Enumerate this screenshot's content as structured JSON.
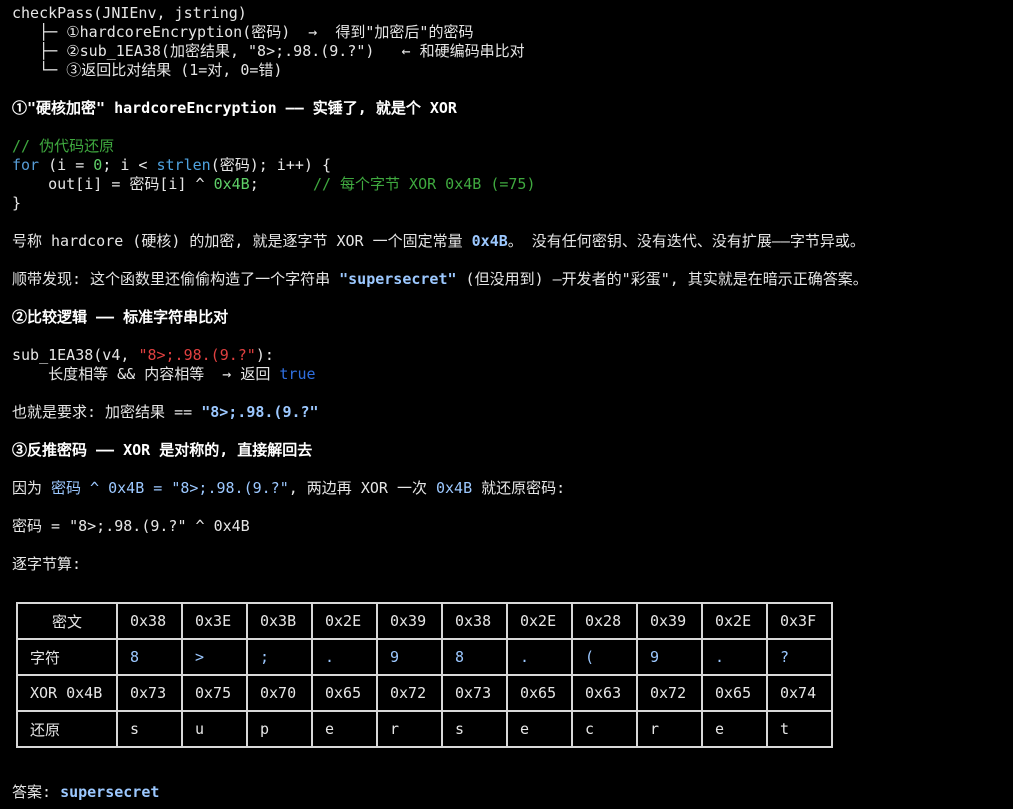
{
  "tree": {
    "root": "checkPass(JNIEnv, jstring)",
    "b1_branch": "   ├─ ",
    "b1_text": "①hardcoreEncryption(密码)  →  得到\"加密后\"的密码",
    "b2_branch": "   ├─ ",
    "b2_text": "②sub_1EA38(加密结果, \"8>;.98.(9.?\")   ← 和硬编码串比对",
    "b3_branch": "   └─ ",
    "b3_text": "③返回比对结果 (1=对, 0=错)"
  },
  "s1": {
    "heading": "①\"硬核加密\" hardcoreEncryption —— 实锤了, 就是个 XOR"
  },
  "code1": {
    "comment": "// 伪代码还原",
    "for_kw": "for",
    "for_a": " (i = ",
    "for_zero": "0",
    "for_b": "; i < ",
    "for_fn": "strlen",
    "for_c": "(密码); i++) {",
    "body_a": "    out[i] = 密码[i] ^ ",
    "body_hex": "0x4B",
    "body_pad": ";      ",
    "body_cmt": "// 每个字节 XOR 0x4B (=75)",
    "close": "}"
  },
  "p1": {
    "a": "号称 hardcore (硬核) 的加密, 就是逐字节 XOR 一个固定常量 ",
    "hl": "0x4B",
    "b": "。 没有任何密钥、没有迭代、没有扩展——字节异或。"
  },
  "p2": {
    "a": "顺带发现: 这个函数里还偷偷构造了一个字符串 ",
    "hl": "\"supersecret\"",
    "b": " (但没用到) —开发者的\"彩蛋\", 其实就是在暗示正确答案。"
  },
  "s2": {
    "heading": "②比较逻辑 —— 标准字符串比对"
  },
  "code2": {
    "call_a": "sub_1EA38(v4, ",
    "call_str": "\"8>;.98.(9.?\"",
    "call_b": "):",
    "line2_a": "    长度相等 && 内容相等  → 返回 ",
    "line2_true": "true"
  },
  "p3": {
    "a": "也就是要求: 加密结果 == ",
    "hl": "\"8>;.98.(9.?\""
  },
  "s3": {
    "heading": "③反推密码 —— XOR 是对称的, 直接解回去"
  },
  "p4": {
    "a": "因为 ",
    "hl1": "密码 ^ 0x4B = \"8>;.98.(9.?\"",
    "b": ", 两边再 XOR 一次 ",
    "hl2": "0x4B",
    "c": " 就还原密码:"
  },
  "p5": {
    "text": "密码 = \"8>;.98.(9.?\" ^ 0x4B"
  },
  "p6": {
    "text": "逐字节算:"
  },
  "table": {
    "rows": [
      {
        "label": "密文",
        "cells": [
          "0x38",
          "0x3E",
          "0x3B",
          "0x2E",
          "0x39",
          "0x38",
          "0x2E",
          "0x28",
          "0x39",
          "0x2E",
          "0x3F"
        ]
      },
      {
        "label": "字符",
        "cells": [
          "8",
          ">",
          ";",
          ".",
          "9",
          "8",
          ".",
          "(",
          "9",
          ".",
          "?"
        ]
      },
      {
        "label": "XOR 0x4B",
        "cells": [
          "0x73",
          "0x75",
          "0x70",
          "0x65",
          "0x72",
          "0x73",
          "0x65",
          "0x63",
          "0x72",
          "0x65",
          "0x74"
        ]
      },
      {
        "label": "还原",
        "cells": [
          "s",
          "u",
          "p",
          "e",
          "r",
          "s",
          "e",
          "c",
          "r",
          "e",
          "t"
        ]
      }
    ]
  },
  "answer": {
    "label": "答案: ",
    "value": "supersecret"
  },
  "colors": {
    "background": "#000000",
    "text": "#d4d4d4",
    "keyword": "#569cd6",
    "number": "#5fd068",
    "comment": "#3fa93f",
    "string": "#e04040",
    "highlight": "#9cc8ff"
  }
}
